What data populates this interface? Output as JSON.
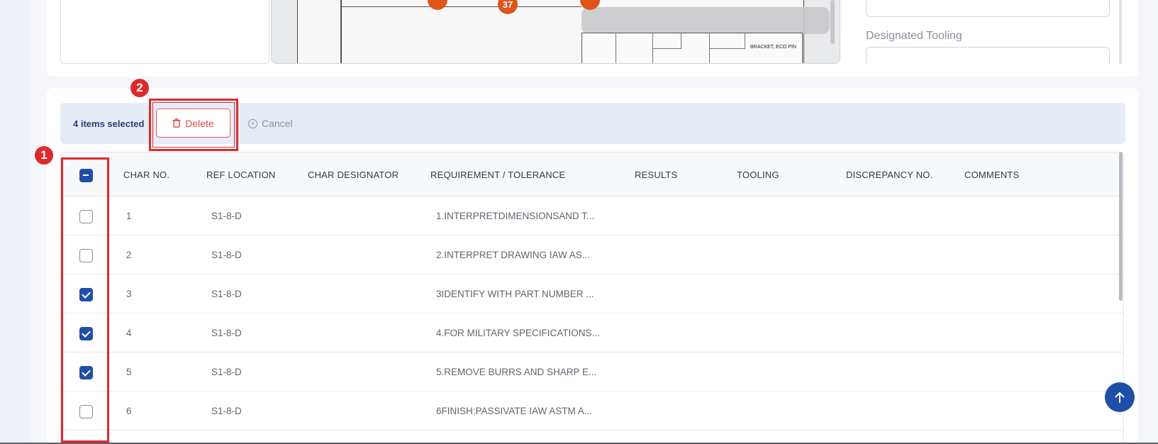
{
  "drawing": {
    "marker_37": "37",
    "title_block_text": "BRACKET, ECO PIN"
  },
  "right_panel": {
    "designated_tooling_label": "Designated Tooling"
  },
  "selection_bar": {
    "count_text": "4 items selected",
    "delete_label": "Delete",
    "cancel_label": "Cancel"
  },
  "table": {
    "columns": [
      "CHAR NO.",
      "REF LOCATION",
      "CHAR DESIGNATOR",
      "REQUIREMENT / TOLERANCE",
      "RESULTS",
      "TOOLING",
      "DISCREPANCY NO.",
      "COMMENTS"
    ],
    "rows": [
      {
        "char_no": "1",
        "ref_location": "S1-8-D",
        "requirement": "1.INTERPRETDIMENSIONSAND T...",
        "checked": false
      },
      {
        "char_no": "2",
        "ref_location": "S1-8-D",
        "requirement": "2.INTERPRET DRAWING IAW AS...",
        "checked": false
      },
      {
        "char_no": "3",
        "ref_location": "S1-8-D",
        "requirement": "3IDENTIFY WITH PART NUMBER ...",
        "checked": true
      },
      {
        "char_no": "4",
        "ref_location": "S1-8-D",
        "requirement": "4.FOR MILITARY SPECIFICATIONS...",
        "checked": true
      },
      {
        "char_no": "5",
        "ref_location": "S1-8-D",
        "requirement": "5.REMOVE BURRS AND SHARP E...",
        "checked": true
      },
      {
        "char_no": "6",
        "ref_location": "S1-8-D",
        "requirement": "6FINISH:PASSIVATE IAW ASTM A...",
        "checked": false
      }
    ]
  },
  "annotations": {
    "badge_1": "1",
    "badge_2": "2"
  },
  "colors": {
    "primary": "#1f4ea8",
    "danger": "#e34848",
    "annotation": "#e0292c",
    "marker": "#e0531b"
  },
  "icons": {
    "delete": "trash-icon",
    "cancel": "circle-x-icon",
    "scroll_top": "arrow-up-icon"
  }
}
